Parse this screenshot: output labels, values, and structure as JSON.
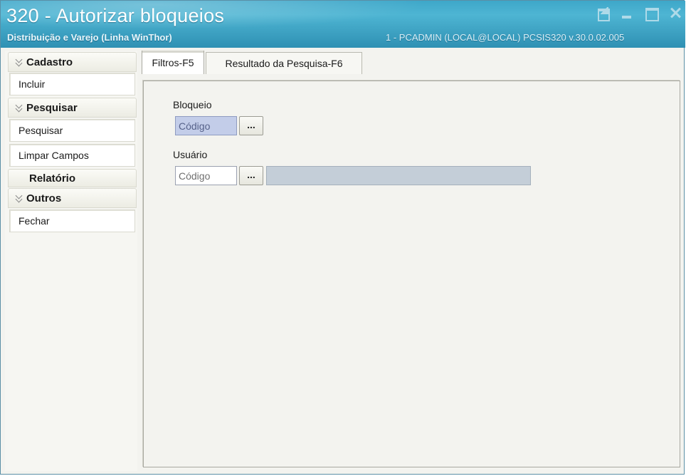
{
  "window": {
    "title": "320 - Autorizar bloqueios",
    "subtitle": "Distribuição e Varejo (Linha WinThor)",
    "session_info": "1 - PCADMIN (LOCAL@LOCAL)   PCSIS320  v.30.0.02.005",
    "controls": {
      "restore_icon": "restore-icon",
      "minimize_icon": "minimize-icon",
      "maximize_icon": "maximize-icon",
      "close_icon": "close-icon"
    }
  },
  "sidebar": {
    "groups": [
      {
        "label": "Cadastro",
        "icon": "chevron-down-icon",
        "items": [
          {
            "label": "Incluir"
          }
        ]
      },
      {
        "label": "Pesquisar",
        "icon": "chevron-down-icon",
        "items": [
          {
            "label": "Pesquisar"
          },
          {
            "label": "Limpar Campos"
          }
        ]
      },
      {
        "label": "Relatório",
        "items": []
      },
      {
        "label": "Outros",
        "icon": "chevron-down-icon",
        "items": [
          {
            "label": "Fechar"
          }
        ]
      }
    ]
  },
  "tabs": [
    {
      "label": "Filtros-F5",
      "active": true
    },
    {
      "label": "Resultado da Pesquisa-F6",
      "active": false
    }
  ],
  "filters": {
    "bloqueio": {
      "label": "Bloqueio",
      "code_placeholder": "Código",
      "lookup_label": "..."
    },
    "usuario": {
      "label": "Usuário",
      "code_placeholder": "Código",
      "lookup_label": "...",
      "description_value": ""
    }
  },
  "colors": {
    "titlebar": "#41a6c6",
    "focused_input": "#c3cde9",
    "readonly_field": "#c4ced8"
  }
}
